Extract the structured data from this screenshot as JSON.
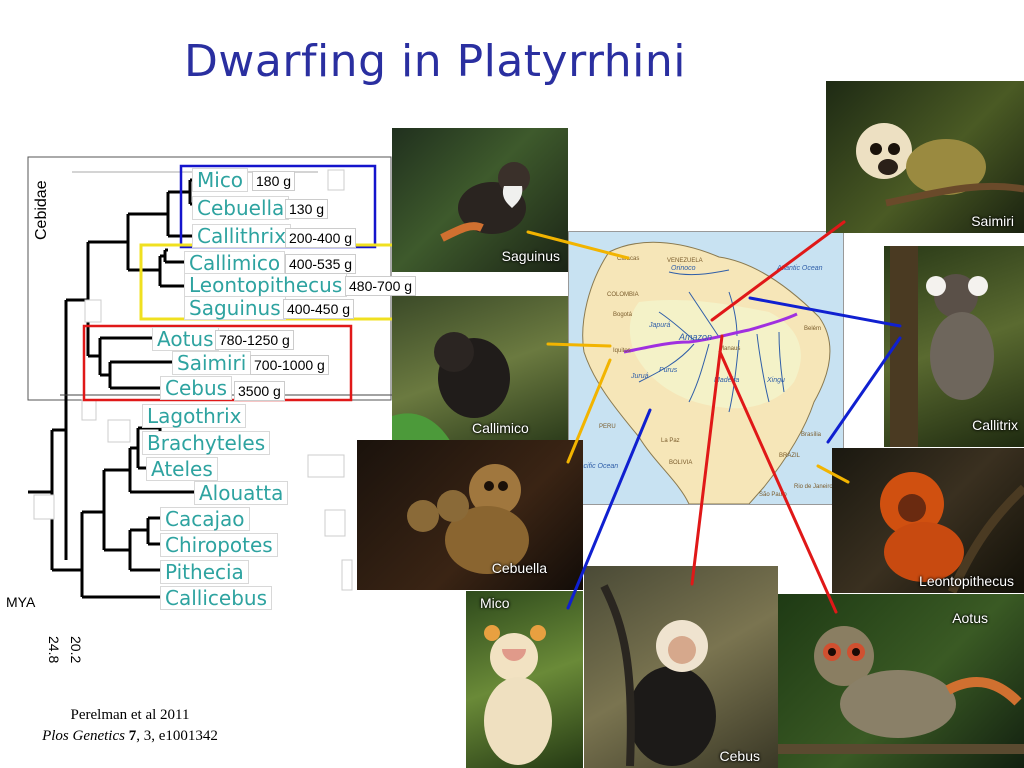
{
  "slide": {
    "title": "Dwarfing in Platyrrhini",
    "tree": {
      "family_label": "Cebidae",
      "scale_label": "MYA",
      "scale_ticks": [
        "24.8",
        "20.2"
      ],
      "genera": [
        {
          "name": "Mico",
          "mass": "180 g"
        },
        {
          "name": "Cebuella",
          "mass": "130 g"
        },
        {
          "name": "Callithrix",
          "mass": "200-400 g"
        },
        {
          "name": "Callimico",
          "mass": "400-535 g"
        },
        {
          "name": "Leontopithecus",
          "mass": "480-700 g"
        },
        {
          "name": "Saguinus",
          "mass": "400-450 g"
        },
        {
          "name": "Aotus",
          "mass": "780-1250 g"
        },
        {
          "name": "Saimiri",
          "mass": "700-1000 g"
        },
        {
          "name": "Cebus",
          "mass": "3500 g"
        },
        {
          "name": "Lagothrix"
        },
        {
          "name": "Brachyteles"
        },
        {
          "name": "Ateles"
        },
        {
          "name": "Alouatta"
        },
        {
          "name": "Cacajao"
        },
        {
          "name": "Chiropotes"
        },
        {
          "name": "Pithecia"
        },
        {
          "name": "Callicebus"
        }
      ]
    },
    "photos": [
      {
        "label": "Saguinus"
      },
      {
        "label": "Callimico"
      },
      {
        "label": "Cebuella"
      },
      {
        "label": "Mico"
      },
      {
        "label": "Cebus"
      },
      {
        "label": "Saimiri"
      },
      {
        "label": "Callitrix"
      },
      {
        "label": "Leontopithecus"
      },
      {
        "label": "Aotus"
      }
    ],
    "map": {
      "labels": {
        "venezuela": "VENEZUELA",
        "colombia": "COLOMBIA",
        "peru": "PERU",
        "bolivia": "BOLIVIA",
        "brazil": "BRAZIL",
        "amazon": "Amazon",
        "atlantic": "Atlantic Ocean",
        "pacific": "Pacific Ocean",
        "caracas": "Caracas",
        "bogota": "Bogotá",
        "lapaz": "La Paz",
        "brasilia": "Brasília",
        "riodejaneiro": "Rio de Janeiro",
        "saopaulo": "São Paulo",
        "belem": "Belém",
        "manaus": "Manaus",
        "purus": "Purus",
        "madeira": "Madeira",
        "jurua": "Juruá",
        "orinoco": "Orinoco",
        "xingu": "Xingu",
        "japura": "Japurá",
        "iquitos": "Iquitos"
      }
    },
    "colors": {
      "title": "#2a2fa0",
      "genus_text": "#2ea3a0",
      "box_blue": "#1414cc",
      "box_yellow": "#f0e020",
      "box_red": "#e01818",
      "line_orange": "#f2b400",
      "line_red": "#e01818",
      "line_blue": "#1020d0",
      "amazon_river": "#a030e0"
    },
    "citation": {
      "line1": "Perelman et al 2011",
      "journal": "Plos Genetics",
      "volume": "7",
      "rest": ", 3, e1001342"
    }
  }
}
